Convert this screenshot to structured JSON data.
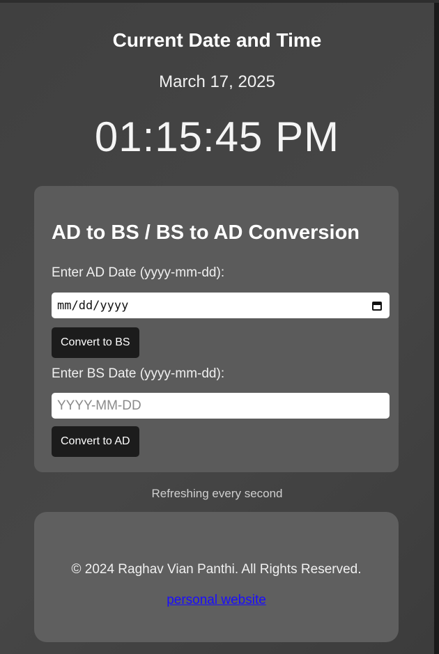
{
  "header": {
    "title": "Current Date and Time",
    "date": "March 17, 2025",
    "time": "01:15:45 PM"
  },
  "converter": {
    "title": "AD to BS / BS to AD Conversion",
    "ad_label": "Enter AD Date (yyyy-mm-dd):",
    "ad_input_value": "mm/dd/yyyy",
    "ad_button": "Convert to BS",
    "bs_label": "Enter BS Date (yyyy-mm-dd):",
    "bs_input_placeholder": "YYYY-MM-DD",
    "bs_button": "Convert to AD"
  },
  "status": {
    "refresh_text": "Refreshing every second"
  },
  "footer": {
    "copyright": "© 2024 Raghav Vian Panthi. All Rights Reserved.",
    "link_text": "personal website"
  },
  "icons": {
    "date_picker": "calendar-icon"
  },
  "colors": {
    "background": "#434343",
    "card": "#5b5b5b",
    "button": "#1c1c1c",
    "link": "#1a0dff"
  }
}
